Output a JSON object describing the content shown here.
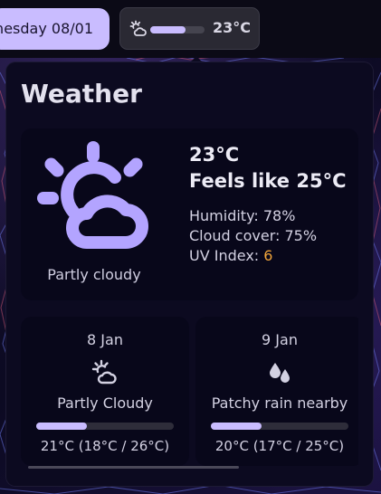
{
  "topbar": {
    "date_label": "nesday 08/01",
    "weather_pill": {
      "icon": "partly-cloudy-icon",
      "temp": "23°C",
      "level": 0.65
    }
  },
  "popup": {
    "title": "Weather",
    "current": {
      "icon": "partly-cloudy-icon",
      "description": "Partly cloudy",
      "temp": "23°C",
      "feels_like": "Feels like 25°C",
      "humidity": "Humidity: 78%",
      "cloud_cover": "Cloud cover: 75%",
      "uv_label": "UV Index: ",
      "uv_value": "6",
      "uv_color": "#f0a43a"
    },
    "forecast": [
      {
        "date": "8 Jan",
        "icon": "partly-cloudy-icon",
        "description": "Partly Cloudy",
        "bar_level": 0.37,
        "range": "21°C (18°C / 26°C)"
      },
      {
        "date": "9 Jan",
        "icon": "rain-drops-icon",
        "description": "Patchy rain nearby",
        "bar_level": 0.37,
        "range": "20°C (17°C / 25°C)"
      }
    ]
  },
  "colors": {
    "accent": "#c9bcff",
    "card_bg": "#08071a",
    "popup_bg": "#0c0a20"
  }
}
